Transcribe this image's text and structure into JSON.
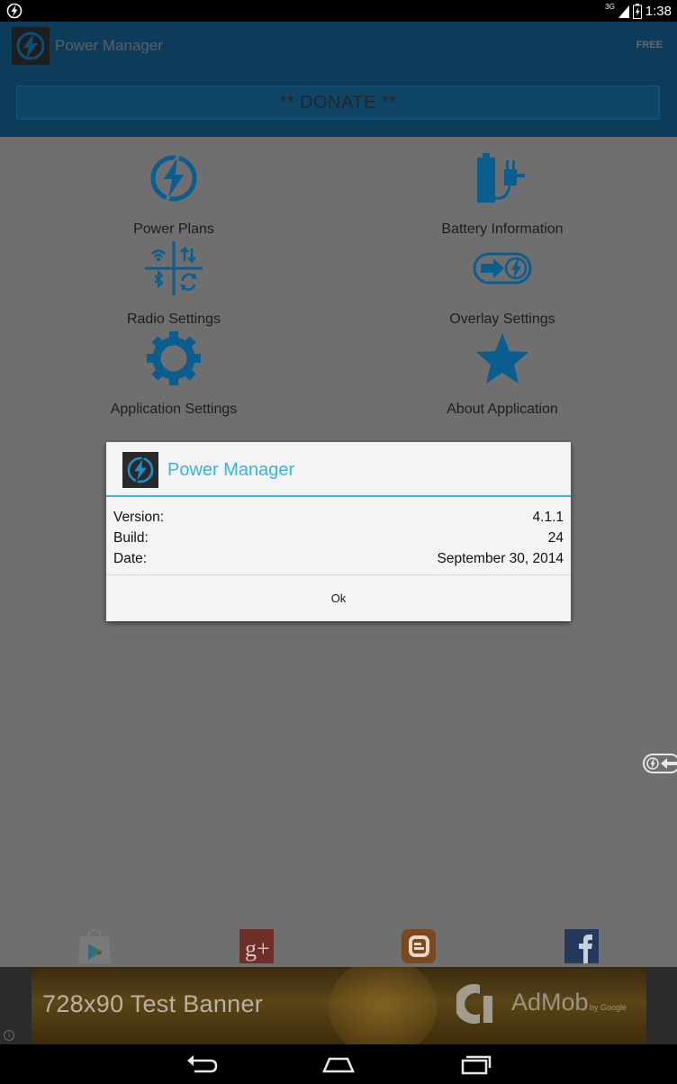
{
  "status_bar": {
    "network": "3G",
    "time": "1:38",
    "icons": [
      "power-manager-notification-icon",
      "signal-icon",
      "battery-icon"
    ]
  },
  "app_bar": {
    "title": "Power Manager",
    "badge": "FREE",
    "donate_label": "** DONATE **"
  },
  "menu": {
    "items": [
      {
        "label": "Power Plans",
        "icon": "lightning-circle-icon"
      },
      {
        "label": "Battery Information",
        "icon": "battery-plug-icon"
      },
      {
        "label": "Radio Settings",
        "icon": "radio-grid-icon"
      },
      {
        "label": "Overlay Settings",
        "icon": "overlay-arrow-icon"
      },
      {
        "label": "Application Settings",
        "icon": "gear-icon"
      },
      {
        "label": "About Application",
        "icon": "star-icon"
      }
    ]
  },
  "dialog": {
    "title": "Power Manager",
    "rows": [
      {
        "label": "Version:",
        "value": "4.1.1"
      },
      {
        "label": "Build:",
        "value": "24"
      },
      {
        "label": "Date:",
        "value": "September 30, 2014"
      }
    ],
    "ok_label": "Ok"
  },
  "social": {
    "icons": [
      "google-play-icon",
      "google-plus-icon",
      "blogger-icon",
      "facebook-icon"
    ]
  },
  "ad": {
    "text": "728x90   Test Banner",
    "brand": "AdMob",
    "by": "by Google"
  },
  "colors": {
    "accent": "#34b5e5",
    "icon_blue": "#0a5e8f",
    "dim_bg": "#6f6f6f"
  }
}
